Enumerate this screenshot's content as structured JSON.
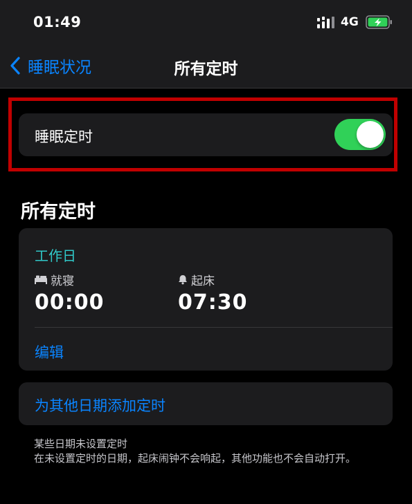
{
  "status_bar": {
    "time": "01:49",
    "network": "4G",
    "icons": [
      "signal-icon",
      "battery-charging-icon"
    ]
  },
  "nav": {
    "back_label": "睡眠状况",
    "title": "所有定时",
    "back_icon": "chevron-left-icon"
  },
  "sleep_schedule": {
    "label": "睡眠定时",
    "enabled": true,
    "switch_color": "#30d158"
  },
  "section": {
    "title": "所有定时"
  },
  "schedule": {
    "days": "工作日",
    "bedtime_label": "就寝",
    "bedtime_icon": "bed-icon",
    "bedtime_value": "00:00",
    "wake_label": "起床",
    "wake_icon": "bell-icon",
    "wake_value": "07:30",
    "edit_label": "编辑"
  },
  "add_schedule": {
    "label": "为其他日期添加定时"
  },
  "footer": {
    "line1": "某些日期未设置定时",
    "line2": "在未设置定时的日期，起床闹钟不会响起，其他功能也不会自动打开。"
  },
  "colors": {
    "accent": "#0a84ff",
    "days_teal": "#30c9c9",
    "highlight_red": "#c00000",
    "background": "#000000",
    "card": "#1c1c1e"
  }
}
